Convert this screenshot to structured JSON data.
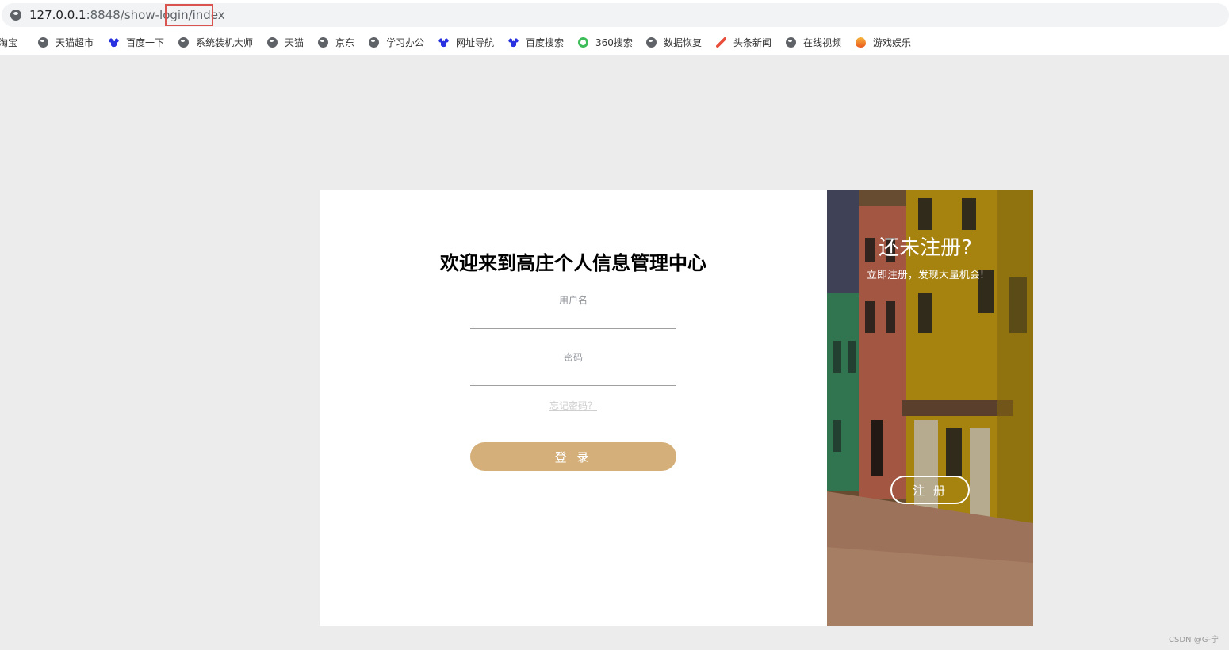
{
  "browser": {
    "url_host": "127.0.0.1",
    "url_rest": ":8848/show-login/index"
  },
  "bookmarks": [
    {
      "label": "爱淘宝",
      "icon": "globe-icon"
    },
    {
      "label": "天猫超市",
      "icon": "globe-icon"
    },
    {
      "label": "百度一下",
      "icon": "baidu-paw-icon"
    },
    {
      "label": "系统装机大师",
      "icon": "globe-icon"
    },
    {
      "label": "天猫",
      "icon": "globe-icon"
    },
    {
      "label": "京东",
      "icon": "globe-icon"
    },
    {
      "label": "学习办公",
      "icon": "globe-icon"
    },
    {
      "label": "网址导航",
      "icon": "baidu-paw-icon"
    },
    {
      "label": "百度搜索",
      "icon": "baidu-paw-icon"
    },
    {
      "label": "360搜索",
      "icon": "360-search-icon"
    },
    {
      "label": "数据恢复",
      "icon": "globe-icon"
    },
    {
      "label": "头条新闻",
      "icon": "toutiao-icon"
    },
    {
      "label": "在线视频",
      "icon": "globe-icon"
    },
    {
      "label": "游戏娱乐",
      "icon": "flame-icon"
    }
  ],
  "login": {
    "title": "欢迎来到高庄个人信息管理中心",
    "username_label": "用户名",
    "username_value": "",
    "password_label": "密码",
    "password_value": "",
    "forgot_link": "忘记密码？",
    "login_button": "登 录"
  },
  "register_panel": {
    "title": "还未注册?",
    "subtitle": "立即注册，发现大量机会!",
    "register_button": "注 册"
  },
  "watermark": "CSDN @G-宁",
  "colors": {
    "login_button": "#d4af7a",
    "page_background": "#ececec",
    "url_highlight_box": "#d9534f"
  }
}
